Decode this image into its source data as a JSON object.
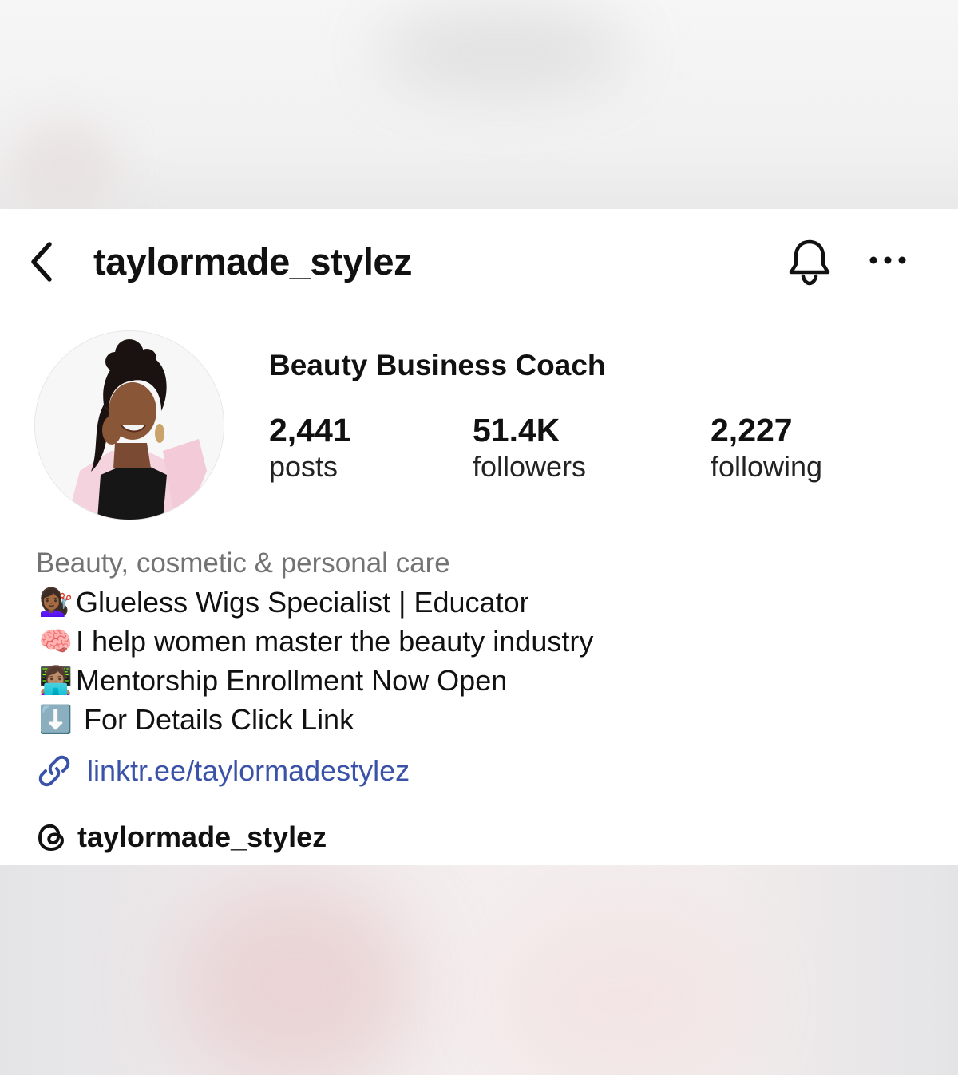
{
  "header": {
    "username": "taylormade_stylez"
  },
  "profile": {
    "display_name": "Beauty Business Coach",
    "stats": [
      {
        "value": "2,441",
        "label": "posts"
      },
      {
        "value": "51.4K",
        "label": "followers"
      },
      {
        "value": "2,227",
        "label": "following"
      }
    ],
    "category": "Beauty, cosmetic & personal care",
    "bio": [
      {
        "emoji": "💇🏾‍♀️",
        "text": "Glueless Wigs Specialist | Educator"
      },
      {
        "emoji": "🧠",
        "text": "I help women master the beauty industry"
      },
      {
        "emoji": "👩🏽‍💻",
        "text": "Mentorship Enrollment Now Open"
      },
      {
        "emoji": "⬇️",
        "text": " For Details Click Link"
      }
    ],
    "link": "linktr.ee/taylormadestylez",
    "threads_handle": "taylormade_stylez"
  },
  "icons": {
    "back": "chevron-left-icon",
    "notifications": "bell-icon",
    "more": "ellipsis-icon",
    "link": "link-icon",
    "threads": "threads-icon"
  },
  "colors": {
    "link": "#3a52a8",
    "secondary_text": "#737373"
  }
}
